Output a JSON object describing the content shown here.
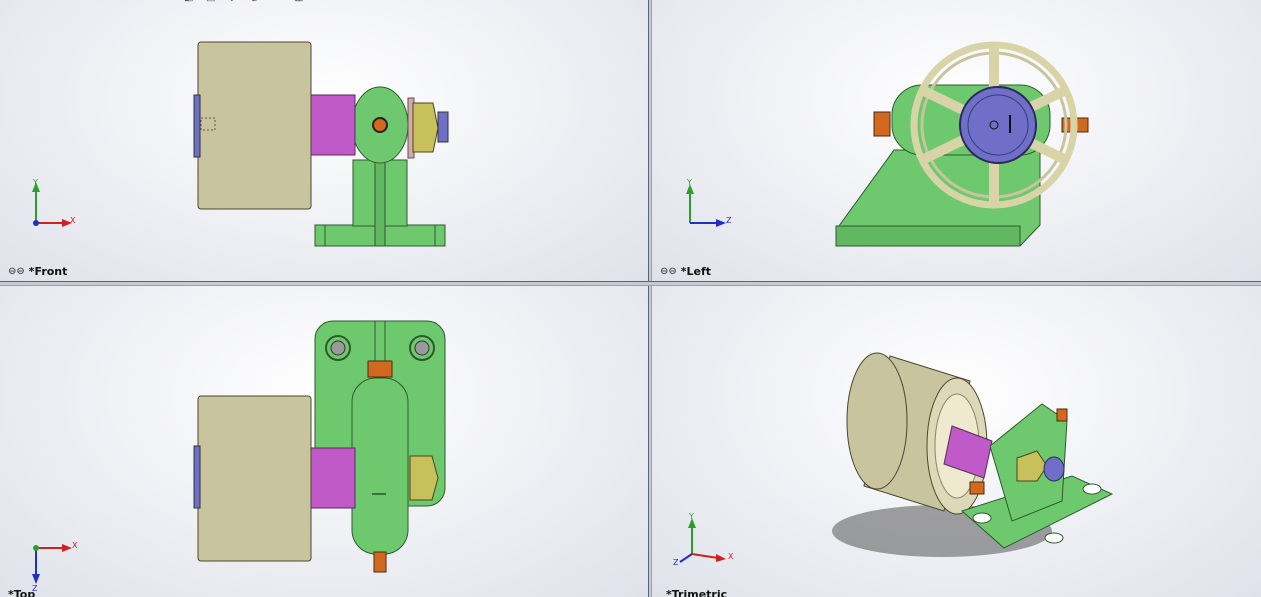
{
  "views": {
    "front": {
      "label": "*Front",
      "axes": {
        "up": "Y",
        "right": "X"
      }
    },
    "left": {
      "label": "*Left",
      "axes": {
        "up": "Y",
        "right": "Z"
      }
    },
    "top": {
      "label": "*Top",
      "axes": {
        "up": "X",
        "down": "Z"
      }
    },
    "trimetric": {
      "label": "*Trimetric",
      "axes": {
        "up": "Y",
        "right": "X",
        "left": "Z"
      }
    }
  },
  "colors": {
    "roller": "#c8c49e",
    "shaft": "#c05ac8",
    "bracket": "#6ec96e",
    "nut": "#c8c05a",
    "pin": "#d2691e",
    "bearing": "#6f6fc8",
    "handwheel": "#d8d4a8"
  },
  "icons": [
    "link-icon",
    "rotate-icon",
    "zoom-icon",
    "section-icon",
    "display-style-icon"
  ]
}
